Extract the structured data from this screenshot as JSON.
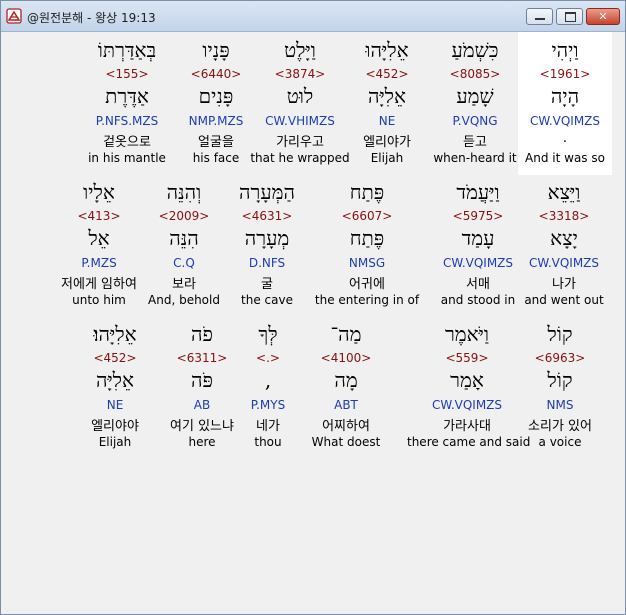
{
  "window": {
    "title": "@원전분해 - 왕상 19:13",
    "controls": {
      "minimize": "minimize-icon",
      "maximize": "maximize-icon",
      "close": "✕"
    }
  },
  "rows": [
    {
      "words": [
        {
          "hebrew": "וַיְהִי",
          "strong": "<1961>",
          "lemma": "הָיָה",
          "parse": "CW.VQIMZS",
          "korean": ".",
          "english": "And it was so",
          "selected": true
        },
        {
          "hebrew": "כִּשְׁמֹעַ",
          "strong": "<8085>",
          "lemma": "שָׁמַע",
          "parse": "P.VQNG",
          "korean": "듣고",
          "english": "when-heard it"
        },
        {
          "hebrew": "אֵלִיָּהוּ",
          "strong": "<452>",
          "lemma": "אֵלִיָּה",
          "parse": "NE",
          "korean": "엘리야가",
          "english": "Elijah"
        },
        {
          "hebrew": "וַיָּלֶט",
          "strong": "<3874>",
          "lemma": "לוּט",
          "parse": "CW.VHIMZS",
          "korean": "가리우고",
          "english": "that he wrapped"
        },
        {
          "hebrew": "פָּנָיו",
          "strong": "<6440>",
          "lemma": "פָּנִים",
          "parse": "NMP.MZS",
          "korean": "얼굴을",
          "english": "his face"
        },
        {
          "hebrew": "בְּאַדַּרְתּוֹ",
          "strong": "<155>",
          "lemma": "אַדֶּרֶת",
          "parse": "P.NFS.MZS",
          "korean": "겉옷으로",
          "english": "in his mantle"
        }
      ]
    },
    {
      "words": [
        {
          "hebrew": "וַיֵּצֵא",
          "strong": "<3318>",
          "lemma": "יָצָא",
          "parse": "CW.VQIMZS",
          "korean": "나가",
          "english": "and went out"
        },
        {
          "hebrew": "וַיַּעֲמֹד",
          "strong": "<5975>",
          "lemma": "עָמַד",
          "parse": "CW.VQIMZS",
          "korean": "서매",
          "english": "and stood in"
        },
        {
          "hebrew": "פֶּתַח",
          "strong": "<6607>",
          "lemma": "פֶּתַח",
          "parse": "NMSG",
          "korean": "어귀에",
          "english": "the entering in of"
        },
        {
          "hebrew": "הַמְּעָרָה",
          "strong": "<4631>",
          "lemma": "מְעָרָה",
          "parse": "D.NFS",
          "korean": "굴",
          "english": "the cave"
        },
        {
          "hebrew": "וְהִנֵּה",
          "strong": "<2009>",
          "lemma": "הִנֵּה",
          "parse": "C.Q",
          "korean": "보라",
          "english": "And, behold"
        },
        {
          "hebrew": "אֵלָיו",
          "strong": "<413>",
          "lemma": "אֵל",
          "parse": "P.MZS",
          "korean": "저에게 임하여",
          "english": "unto him"
        }
      ]
    },
    {
      "words": [
        {
          "hebrew": "קוֹל",
          "strong": "<6963>",
          "lemma": "קוֹל",
          "parse": "NMS",
          "korean": "소리가 있어",
          "english": "a voice"
        },
        {
          "hebrew": "וַיֹּאמֶר",
          "strong": "<559>",
          "lemma": "אָמַר",
          "parse": "CW.VQIMZS",
          "korean": "가라사대",
          "english": "there came and said"
        },
        {
          "hebrew": "מַה־",
          "strong": "<4100>",
          "lemma": "מָה",
          "parse": "ABT",
          "korean": "어찌하여",
          "english": "What doest"
        },
        {
          "hebrew": "לְּךָ",
          "strong": "<.>",
          "lemma": ",",
          "parse": "P.MYS",
          "korean": "네가",
          "english": "thou"
        },
        {
          "hebrew": "פֹה",
          "strong": "<6311>",
          "lemma": "פֹּה",
          "parse": "AB",
          "korean": "여기 있느냐",
          "english": "here"
        },
        {
          "hebrew": "אֵלִיָּהוּ׃",
          "strong": "<452>",
          "lemma": "אֵלִיָּה",
          "parse": "NE",
          "korean": "엘리야야",
          "english": "Elijah"
        }
      ]
    }
  ]
}
